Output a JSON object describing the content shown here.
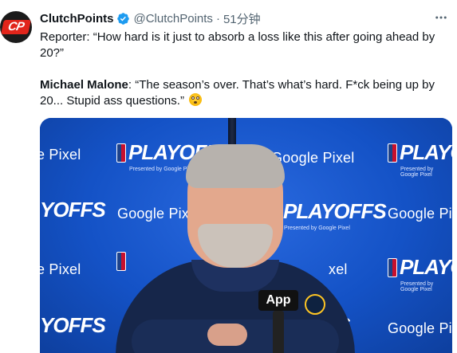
{
  "author": {
    "name": "ClutchPoints",
    "handle": "@ClutchPoints",
    "separator": "·",
    "time": "51分钟",
    "avatar_text": "CP",
    "verified": true
  },
  "tweet": {
    "paragraph1": "Reporter: “How hard is it just to absorb a loss like this after going ahead by 20?”",
    "speaker": "Michael Malone",
    "quote": ": “The season’s over. That’s what’s hard. F*ck being up by 20... Stupid ass questions.”",
    "emoji": "flushed-face-emoji"
  },
  "media": {
    "backdrop_brands": {
      "google_pixel": "Google Pixel",
      "google_pixel_partial": "Google Pixe",
      "google_pixel_right": "Google Pi",
      "pixel_left": "e Pixel",
      "pixel_left2": "e Pixel",
      "playoffs": "PLAYOFFS",
      "playoffs_right": "PLAYOFF",
      "playoffs_left": "YOFFS",
      "playoffs_left2": "YOFFS",
      "playoffs_sub": "Presented by Google Pixel",
      "xel": "xel",
      "s": "S"
    },
    "mic_label": "App"
  },
  "colors": {
    "accent": "#1d9bf0",
    "secondary_text": "#536471",
    "backdrop": "#1552c4"
  },
  "icons": {
    "more": "more-horizontal-icon",
    "verified": "verified-badge-icon"
  }
}
